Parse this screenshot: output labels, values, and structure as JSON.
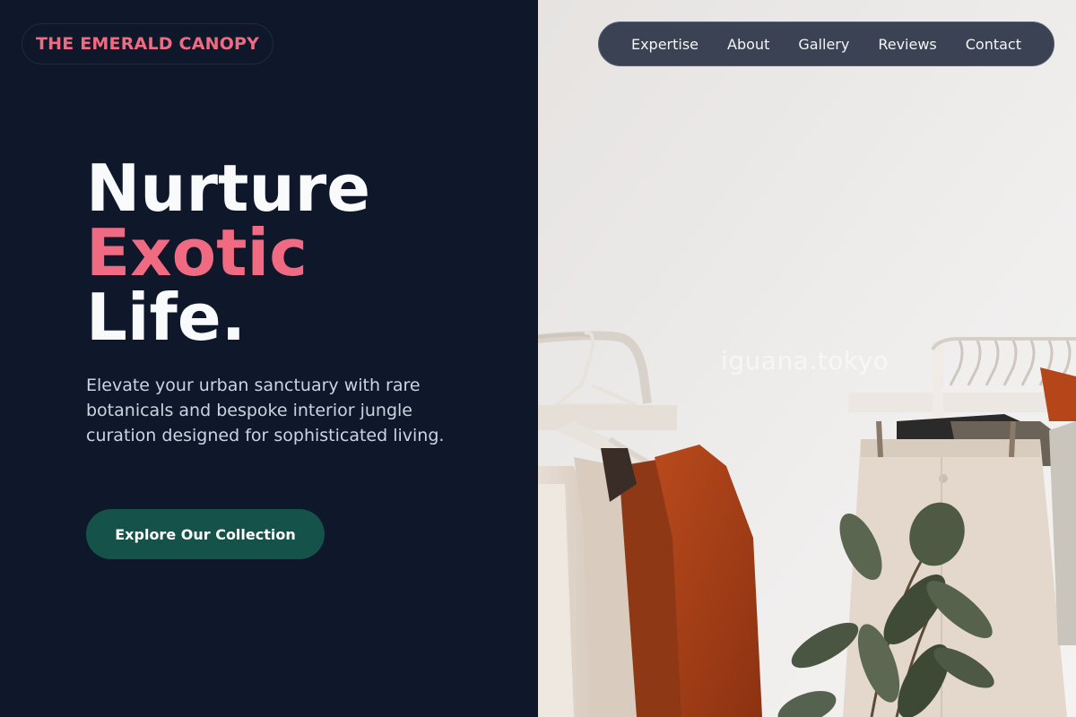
{
  "brand": {
    "name": "THE EMERALD CANOPY"
  },
  "nav": {
    "items": [
      {
        "label": "Expertise"
      },
      {
        "label": "About"
      },
      {
        "label": "Gallery"
      },
      {
        "label": "Reviews"
      },
      {
        "label": "Contact"
      }
    ]
  },
  "hero": {
    "line1": "Nurture",
    "line2": "Exotic",
    "line3": "Life.",
    "description": "Elevate your urban sanctuary with rare botanicals and bespoke interior jungle curation designed for sophisticated living.",
    "cta_label": "Explore Our Collection"
  },
  "photo": {
    "watermark": "iguana.tokyo",
    "subject": "clothing racks with hanging garments and a potted rubber plant"
  },
  "colors": {
    "background": "#0f172a",
    "accent": "#f06b82",
    "cta": "#15524a",
    "nav_bg": "#3a4253"
  }
}
